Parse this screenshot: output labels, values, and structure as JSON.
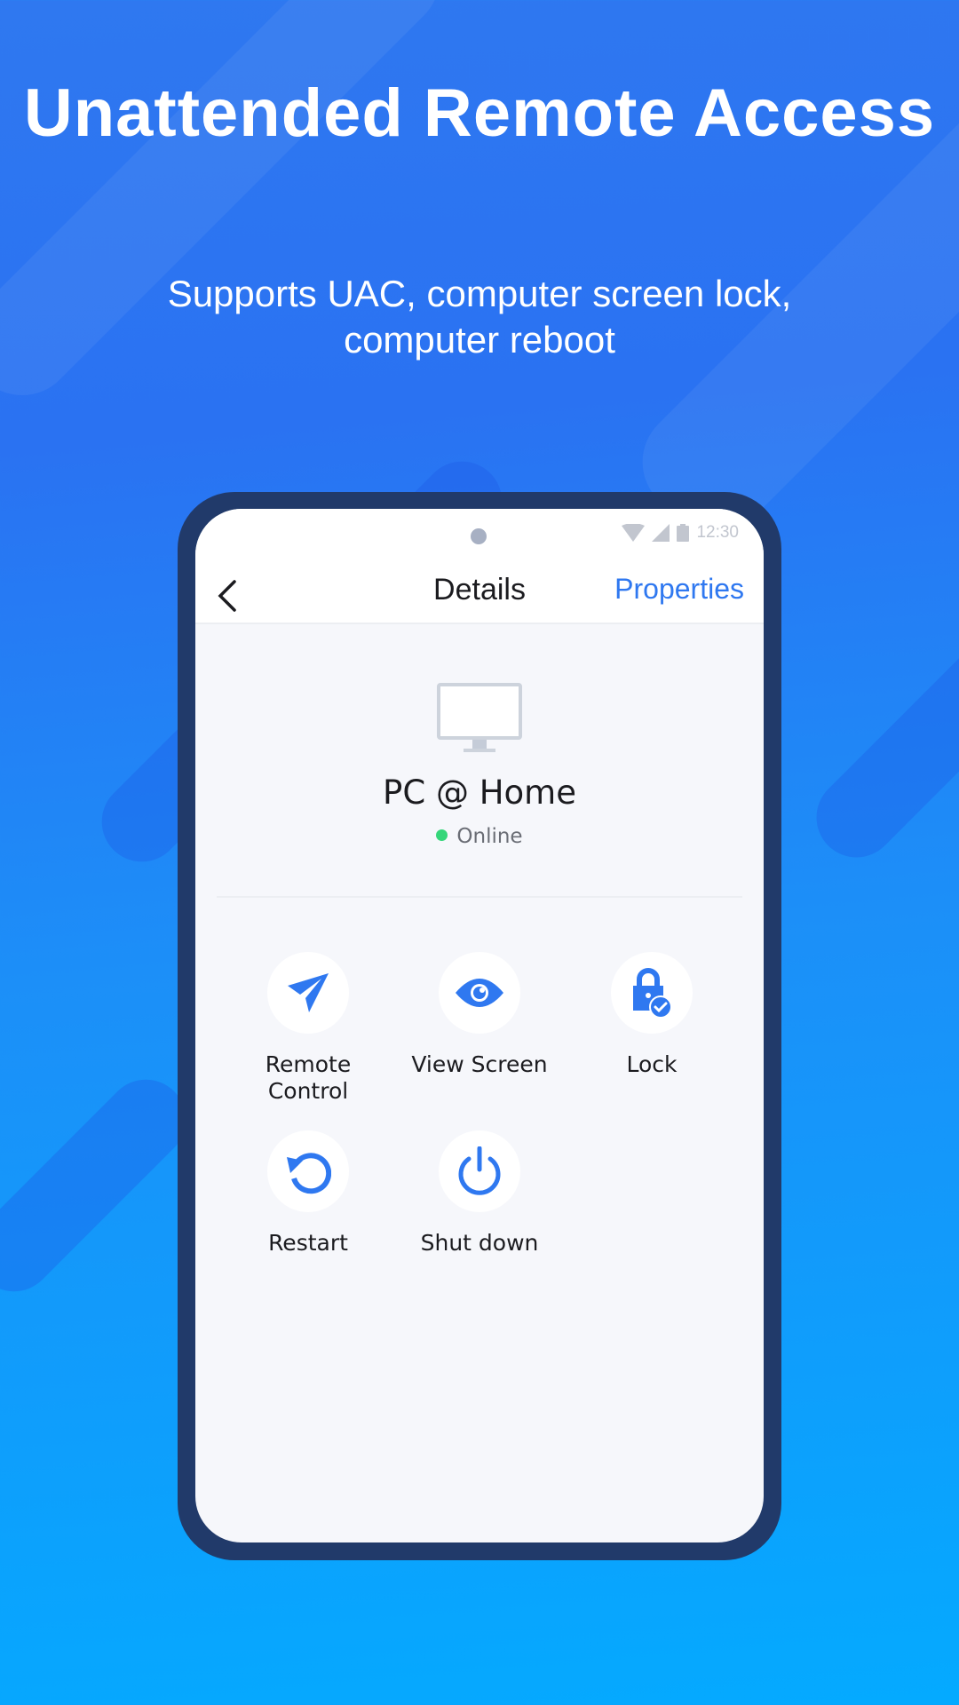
{
  "hero": {
    "title": "Unattended Remote Access",
    "subtitle_line1": "Supports UAC, computer screen lock,",
    "subtitle_line2": "computer reboot"
  },
  "status_bar": {
    "time": "12:30"
  },
  "nav": {
    "title": "Details",
    "properties_label": "Properties",
    "back_icon": "chevron-left-icon"
  },
  "device": {
    "name": "PC @ Home",
    "status": "Online",
    "status_color": "#35d67a",
    "icon": "monitor-icon"
  },
  "actions": [
    {
      "label": "Remote\nControl",
      "icon": "paper-plane-icon"
    },
    {
      "label": "View Screen",
      "icon": "eye-icon"
    },
    {
      "label": "Lock",
      "icon": "lock-check-icon"
    },
    {
      "label": "Restart",
      "icon": "restart-icon"
    },
    {
      "label": "Shut down",
      "icon": "power-icon"
    }
  ],
  "colors": {
    "accent": "#2f78f0",
    "phone_frame": "#213a6a"
  }
}
